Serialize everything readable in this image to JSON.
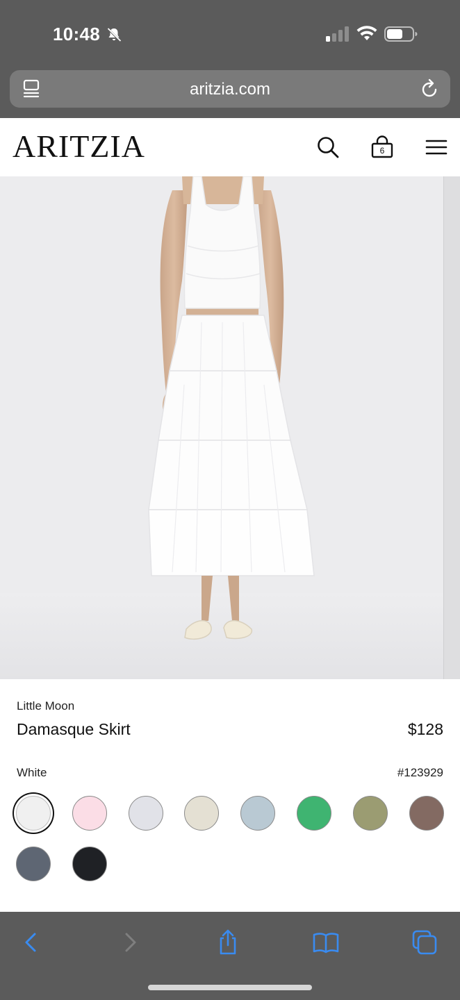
{
  "status": {
    "time": "10:48"
  },
  "browser": {
    "url": "aritzia.com"
  },
  "header": {
    "logo": "ARITZIA",
    "bag_count": "6"
  },
  "product": {
    "brand": "Little Moon",
    "name": "Damasque Skirt",
    "price": "$128",
    "color_name": "White",
    "sku": "#123929"
  },
  "swatches": [
    {
      "name": "white",
      "hex": "#f0f0f0",
      "selected": true
    },
    {
      "name": "pink",
      "hex": "#fbdde6"
    },
    {
      "name": "light-grey",
      "hex": "#e1e2e8"
    },
    {
      "name": "cream",
      "hex": "#e4e0d3"
    },
    {
      "name": "light-blue",
      "hex": "#b9c9d3"
    },
    {
      "name": "green",
      "hex": "#3fb471"
    },
    {
      "name": "olive",
      "hex": "#9b9c72"
    },
    {
      "name": "brown",
      "hex": "#836a62"
    },
    {
      "name": "slate",
      "hex": "#5e6673"
    },
    {
      "name": "black",
      "hex": "#1f2125"
    }
  ],
  "colors": {
    "chrome": "#5b5b5b",
    "ios_blue": "#3a8bf0",
    "hero_bg": "#ececee"
  }
}
